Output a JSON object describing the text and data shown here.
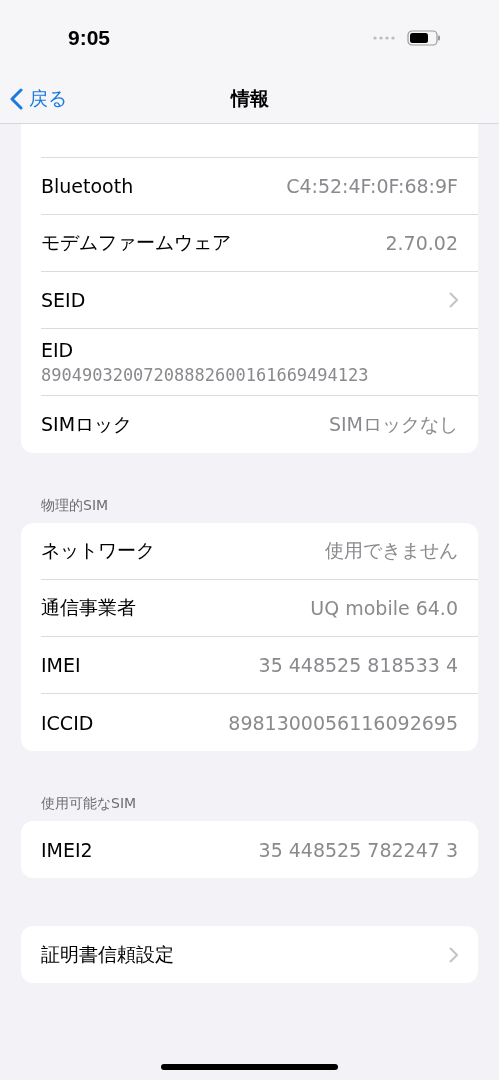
{
  "status_bar": {
    "time": "9:05"
  },
  "nav": {
    "back": "戻る",
    "title": "情報"
  },
  "sections": [
    {
      "rows": [
        {
          "kind": "value",
          "label": "Bluetooth",
          "value": "C4:52:4F:0F:68:9F"
        },
        {
          "kind": "value",
          "label": "モデムファームウェア",
          "value": "2.70.02"
        },
        {
          "kind": "chevron",
          "label": "SEID"
        },
        {
          "kind": "stacked",
          "label": "EID",
          "value": "89049032007208882600161669494123"
        },
        {
          "kind": "value",
          "label": "SIMロック",
          "value": "SIMロックなし"
        }
      ]
    },
    {
      "header": "物理的SIM",
      "rows": [
        {
          "kind": "value",
          "label": "ネットワーク",
          "value": "使用できません"
        },
        {
          "kind": "value",
          "label": "通信事業者",
          "value": "UQ mobile 64.0"
        },
        {
          "kind": "value",
          "label": "IMEI",
          "value": "35 448525 818533 4"
        },
        {
          "kind": "value",
          "label": "ICCID",
          "value": "8981300056116092695"
        }
      ]
    },
    {
      "header": "使用可能なSIM",
      "rows": [
        {
          "kind": "value",
          "label": "IMEI2",
          "value": "35 448525 782247 3"
        }
      ]
    },
    {
      "rows": [
        {
          "kind": "chevron",
          "label": "証明書信頼設定"
        }
      ]
    }
  ]
}
